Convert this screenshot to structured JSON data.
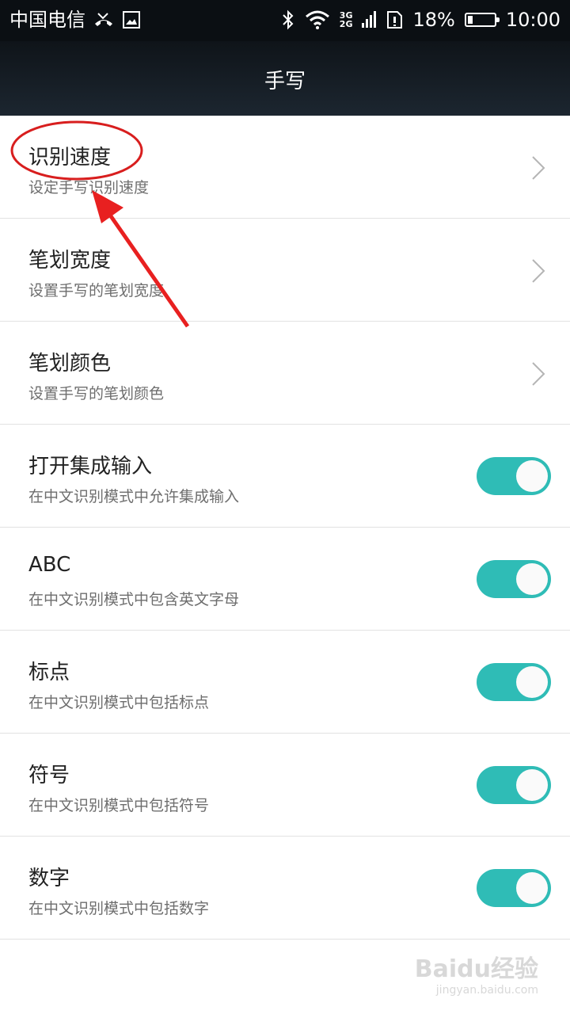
{
  "status": {
    "carrier": "中国电信",
    "net_top": "3G",
    "net_bottom": "2G",
    "battery": "18%",
    "battery_level": 0.18,
    "time": "10:00",
    "icons": [
      "missed-call-icon",
      "gallery-icon",
      "bluetooth-icon",
      "wifi-icon",
      "signal-icon",
      "sim-icon",
      "battery-icon"
    ]
  },
  "title": "手写",
  "accent": "#2fbcb6",
  "rows": [
    {
      "title": "识别速度",
      "subtitle": "设定手写识别速度",
      "type": "chevron"
    },
    {
      "title": "笔划宽度",
      "subtitle": "设置手写的笔划宽度",
      "type": "chevron"
    },
    {
      "title": "笔划颜色",
      "subtitle": "设置手写的笔划颜色",
      "type": "chevron"
    },
    {
      "title": "打开集成输入",
      "subtitle": "在中文识别模式中允许集成输入",
      "type": "toggle",
      "on": true
    },
    {
      "title": "ABC",
      "subtitle": "在中文识别模式中包含英文字母",
      "type": "toggle",
      "on": true
    },
    {
      "title": "标点",
      "subtitle": "在中文识别模式中包括标点",
      "type": "toggle",
      "on": true
    },
    {
      "title": "符号",
      "subtitle": "在中文识别模式中包括符号",
      "type": "toggle",
      "on": true
    },
    {
      "title": "数字",
      "subtitle": "在中文识别模式中包括数字",
      "type": "toggle",
      "on": true
    }
  ],
  "watermark": {
    "brand": "Baidu经验",
    "url": "jingyan.baidu.com"
  }
}
